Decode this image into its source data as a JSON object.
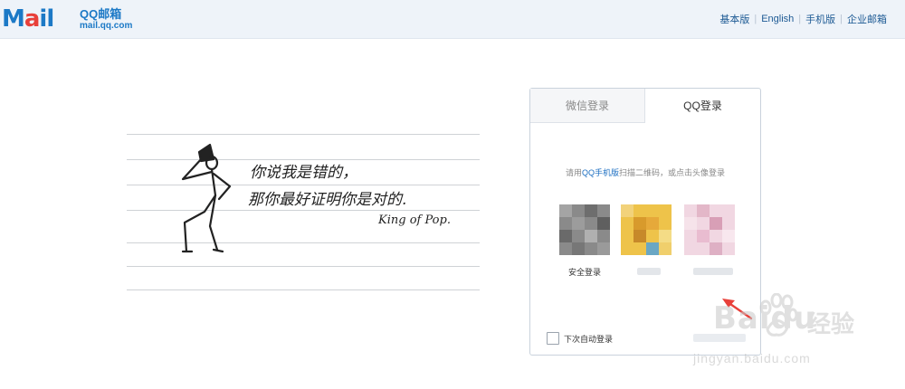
{
  "header": {
    "logo_main": "Mail",
    "logo_cn": "QQ邮箱",
    "logo_url": "mail.qq.com",
    "links": [
      "基本版",
      "English",
      "手机版",
      "企业邮箱"
    ]
  },
  "art": {
    "line1": "你说我是错的，",
    "line2": "那你最好证明你是对的.",
    "signature": "King of Pop."
  },
  "login": {
    "tabs": [
      "微信登录",
      "QQ登录"
    ],
    "active_tab": "QQ登录",
    "hint_prefix": "请用",
    "hint_link": "QQ手机版",
    "hint_suffix": "扫描二维码，或点击头像登录",
    "accounts": [
      {
        "label": "安全登录"
      }
    ],
    "remember_label": "下次自动登录"
  },
  "watermark": {
    "brand": "Baidu",
    "cn": "经验",
    "url": "jingyan.baidu.com"
  },
  "colors": {
    "accent": "#1c79c6",
    "header_bg": "#eef3f9",
    "arrow": "#e8403a"
  }
}
